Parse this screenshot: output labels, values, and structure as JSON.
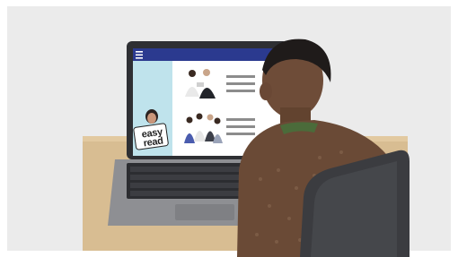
{
  "photo": {
    "scene": "person-at-laptop-easy-read-website",
    "colors": {
      "background": "#ececec",
      "desk": "#d6b98e",
      "screen_header": "#2b3a8f",
      "screen_sidebar": "#bfe3ec",
      "screen_body": "#ffffff",
      "laptop_body": "#8e8f93",
      "sweater": "#6a4a36",
      "chair": "#3b3c40"
    }
  },
  "screen": {
    "menu_icon": "hamburger-icon",
    "easy_read_logo": [
      "easy",
      "read"
    ]
  }
}
